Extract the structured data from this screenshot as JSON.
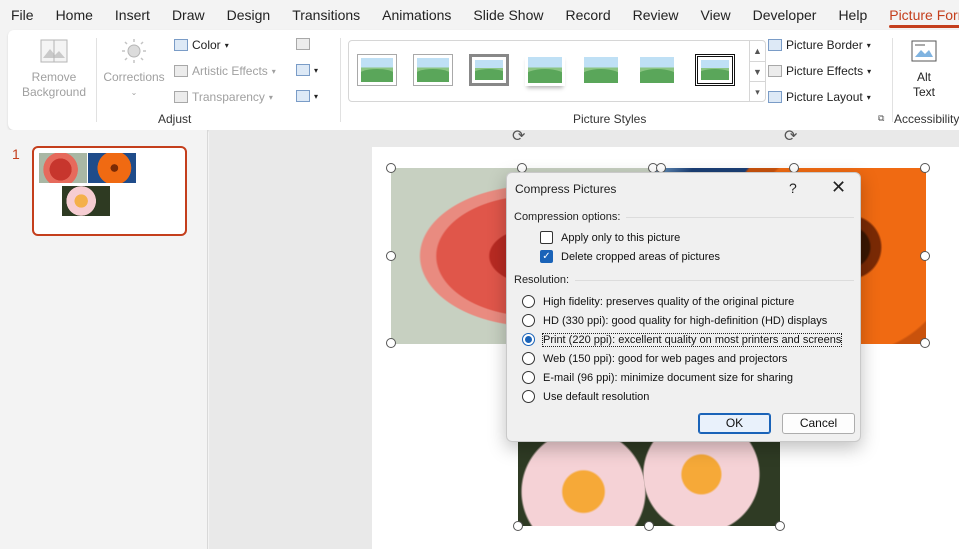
{
  "menu": {
    "tabs": [
      "File",
      "Home",
      "Insert",
      "Draw",
      "Design",
      "Transitions",
      "Animations",
      "Slide Show",
      "Record",
      "Review",
      "View",
      "Developer",
      "Help",
      "Picture Format"
    ],
    "active_tab": "Picture Format"
  },
  "ribbon": {
    "adjust": {
      "remove_background_line1": "Remove",
      "remove_background_line2": "Background",
      "corrections": "Corrections",
      "color": "Color",
      "artistic_effects": "Artistic Effects",
      "transparency": "Transparency",
      "group_label": "Adjust"
    },
    "picture_styles": {
      "group_label": "Picture Styles",
      "picture_border": "Picture Border",
      "picture_effects": "Picture Effects",
      "picture_layout": "Picture Layout"
    },
    "accessibility": {
      "alt_text_line1": "Alt",
      "alt_text_line2": "Text",
      "group_label": "Accessibility"
    }
  },
  "slides_pane": {
    "slide_number": "1"
  },
  "dialog": {
    "title": "Compress Pictures",
    "help": "?",
    "close": "✕",
    "compression_options_label": "Compression options:",
    "apply_only": {
      "label": "Apply only to this picture",
      "checked": false
    },
    "delete_cropped": {
      "label": "Delete cropped areas of pictures",
      "checked": true
    },
    "resolution_label": "Resolution:",
    "resolutions": [
      {
        "label": "High fidelity: preserves quality of the original picture",
        "selected": false
      },
      {
        "label": "HD (330 ppi): good quality for high-definition (HD) displays",
        "selected": false
      },
      {
        "label": "Print (220 ppi): excellent quality on most printers and screens",
        "selected": true
      },
      {
        "label": "Web (150 ppi): good for web pages and projectors",
        "selected": false
      },
      {
        "label": "E-mail (96 ppi): minimize document size for sharing",
        "selected": false
      },
      {
        "label": "Use default resolution",
        "selected": false
      }
    ],
    "ok": "OK",
    "cancel": "Cancel"
  },
  "colors": {
    "accent": "#c43e1c",
    "dialog_blue": "#1a63b8"
  }
}
